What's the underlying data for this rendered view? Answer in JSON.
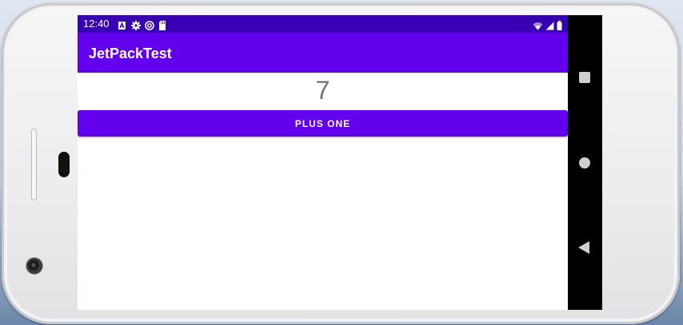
{
  "status_bar": {
    "time": "12:40",
    "left_icons": [
      "text-a-icon",
      "gear-icon",
      "sync-icon",
      "sd-card-icon"
    ],
    "right_icons": [
      "wifi-icon",
      "signal-icon",
      "battery-icon"
    ],
    "color": "#3700b3"
  },
  "app_bar": {
    "title": "JetPackTest",
    "color": "#6200ee"
  },
  "content": {
    "counter_value": "7",
    "plus_button_label": "PLUS ONE"
  },
  "nav_bar": {
    "buttons": [
      "recents-icon",
      "home-icon",
      "back-icon"
    ]
  }
}
